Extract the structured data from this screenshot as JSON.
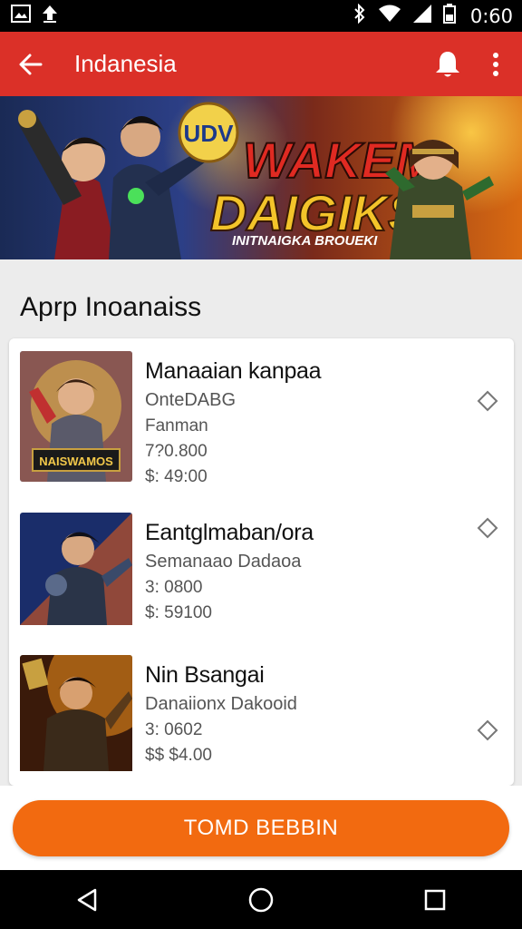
{
  "status_bar": {
    "time": "0:60",
    "icons": [
      "image-icon",
      "upload-icon",
      "bluetooth-icon",
      "wifi-icon",
      "signal-icon",
      "battery-icon"
    ]
  },
  "app_bar": {
    "title": "Indanesia",
    "back_icon": "arrow-left-icon",
    "bell_icon": "bell-icon",
    "more_icon": "more-vert-icon",
    "color": "#db3028"
  },
  "banner": {
    "badge": "UDV",
    "title_line1": "WAKEM",
    "title_line2": "DAIGIKS",
    "subtitle": "INITNAIGKA BROUEKI"
  },
  "section": {
    "title": "Aprp Inoanaiss"
  },
  "items": [
    {
      "name": "Manaaian kanpaa",
      "line1": "OnteDABG",
      "line2": "Fanman",
      "line3": "7?0.800",
      "line4": "$: 49:00",
      "thumb_caption": "NAISWAMOS"
    },
    {
      "name": "Eantglmaban/ora",
      "line1": "Semanaao Dadaoa",
      "line2": "3: 0800",
      "line3": "$: 59100",
      "line4": ""
    },
    {
      "name": "Nin Bsangai",
      "line1": "Danaiionx Dakooid",
      "line2": "3: 0602",
      "line3": "$$ $4.00",
      "line4": ""
    }
  ],
  "cta": {
    "label": "TOMD BEBBIN",
    "color": "#f26a10"
  },
  "nav": {
    "icons": [
      "back-triangle-icon",
      "home-circle-icon",
      "recents-square-icon"
    ]
  }
}
